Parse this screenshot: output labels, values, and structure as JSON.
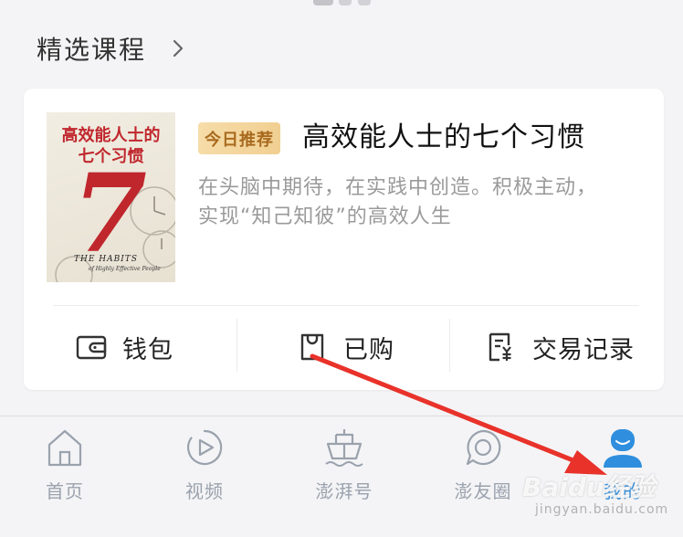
{
  "section": {
    "title": "精选课程",
    "chevron_icon": "chevron-right-icon"
  },
  "featured": {
    "badge": "今日推荐",
    "title": "高效能人士的七个习惯",
    "description_line1": "在头脑中期待，在实践中创造。积极主动，",
    "description_line2": "实现“知己知彼”的高效人生",
    "cover": {
      "title_line1": "高效能人士的",
      "title_line2": "七个习惯",
      "big_number": "7",
      "subtitle": "THE HABITS",
      "subtitle_small": "of Highly Effective People"
    }
  },
  "actions": [
    {
      "label": "钱包",
      "icon": "wallet-icon"
    },
    {
      "label": "已购",
      "icon": "purchased-bag-icon"
    },
    {
      "label": "交易记录",
      "icon": "transaction-receipt-icon"
    }
  ],
  "tabbar": [
    {
      "label": "首页",
      "icon": "home-icon"
    },
    {
      "label": "视频",
      "icon": "play-icon"
    },
    {
      "label": "澎湃号",
      "icon": "ship-icon"
    },
    {
      "label": "澎友圈",
      "icon": "chat-bubble-icon"
    },
    {
      "label": "我的",
      "icon": "user-icon",
      "active": true
    }
  ],
  "colors": {
    "accent": "#2f8fde",
    "badge_text": "#a86a1e",
    "annotation_arrow": "#e8322a",
    "cover_red": "#c0272d"
  },
  "watermark": {
    "logo": "Baidu经验",
    "url": "jingyan.baidu.com"
  }
}
